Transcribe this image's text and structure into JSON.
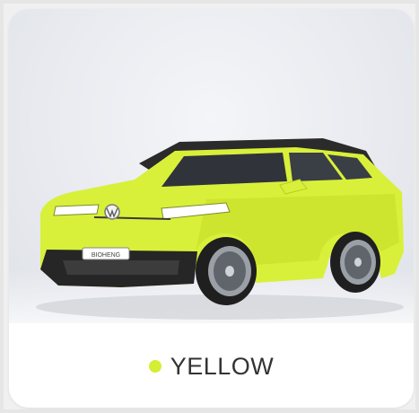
{
  "color_option": {
    "name": "YELLOW",
    "swatch_color": "#d4ee34"
  },
  "vehicle": {
    "badge_text": "BIOHENG",
    "body_color": "#d9f03a",
    "roof_color": "#2b2b2b"
  }
}
